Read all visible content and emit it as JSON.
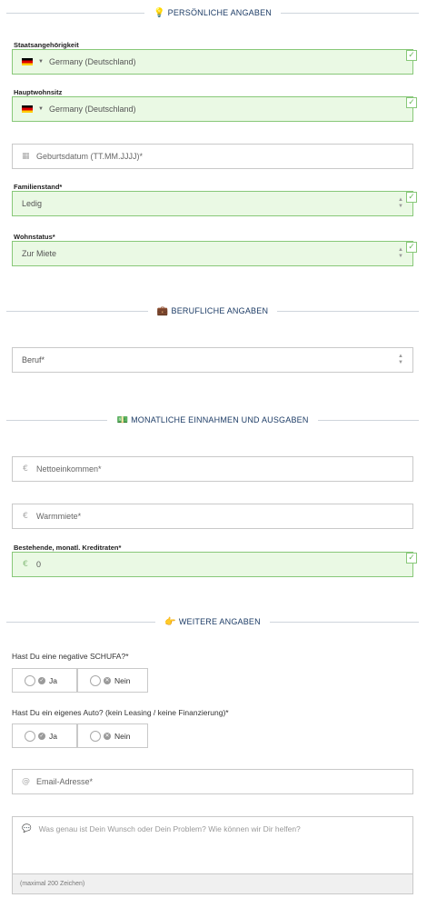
{
  "sections": {
    "personal": {
      "icon": "💡",
      "title": "PERSÖNLICHE ANGABEN"
    },
    "professional": {
      "icon": "💼",
      "title": "BERUFLICHE ANGABEN"
    },
    "monthly": {
      "icon": "💵",
      "title": "MONATLICHE EINNAHMEN UND AUSGABEN"
    },
    "further": {
      "icon": "👉",
      "title": "WEITERE ANGABEN"
    }
  },
  "personal": {
    "nationality": {
      "label": "Staatsangehörigkeit",
      "value": "Germany (Deutschland)",
      "flag": "de-flag-icon"
    },
    "residence": {
      "label": "Hauptwohnsitz",
      "value": "Germany (Deutschland)",
      "flag": "de-flag-icon"
    },
    "birthdate": {
      "placeholder": "Geburtsdatum (TT.MM.JJJJ)*"
    },
    "marital": {
      "label": "Familienstand*",
      "value": "Ledig"
    },
    "housing": {
      "label": "Wohnstatus*",
      "value": "Zur Miete"
    }
  },
  "professional": {
    "job": {
      "value": "Beruf*"
    }
  },
  "monthly": {
    "currency_symbol": "€",
    "net_income": {
      "placeholder": "Nettoeinkommen*"
    },
    "warm_rent": {
      "placeholder": "Warmmiete*"
    },
    "credit_rates": {
      "label": "Bestehende, monatl. Kreditraten*",
      "value": "0"
    }
  },
  "further": {
    "schufa": {
      "question": "Hast Du eine negative SCHUFA?*",
      "yes": "Ja",
      "no": "Nein"
    },
    "car": {
      "question": "Hast Du ein eigenes Auto? (kein Leasing / keine Finanzierung)*",
      "yes": "Ja",
      "no": "Nein"
    },
    "email": {
      "symbol": "@",
      "placeholder": "Email-Adresse*"
    },
    "message": {
      "placeholder": "Was genau ist Dein Wunsch oder Dein Problem? Wie können wir Dir helfen?",
      "counter": "(maximal 200 Zeichen)"
    }
  },
  "colors": {
    "valid_bg": "#eaf9e4",
    "valid_border": "#88c879",
    "heading": "#1d3c66"
  }
}
